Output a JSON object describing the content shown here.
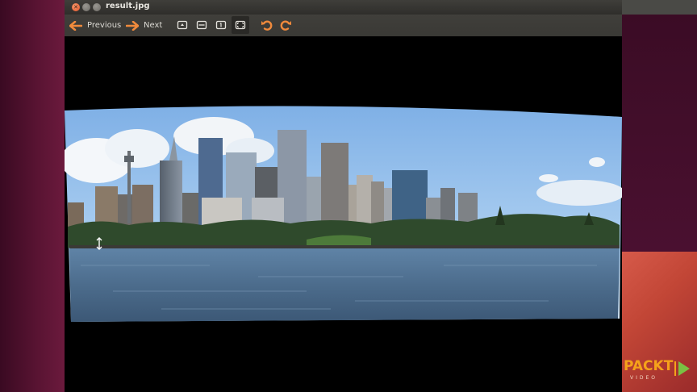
{
  "window": {
    "title": "result.jpg"
  },
  "toolbar": {
    "previous_label": "Previous",
    "next_label": "Next",
    "icons": [
      "zoom-fit-icon",
      "zoom-width-icon",
      "zoom-original-icon",
      "fullscreen-icon",
      "rotate-left-icon",
      "rotate-right-icon"
    ]
  },
  "brand": {
    "name": "PACKT",
    "sub": "VIDEO"
  },
  "colors": {
    "accent": "#e87a3a",
    "titlebar": "#3a3935",
    "logo": "#f5a21a",
    "sky": "#9ec6ee",
    "water": "#4f6e8c"
  }
}
